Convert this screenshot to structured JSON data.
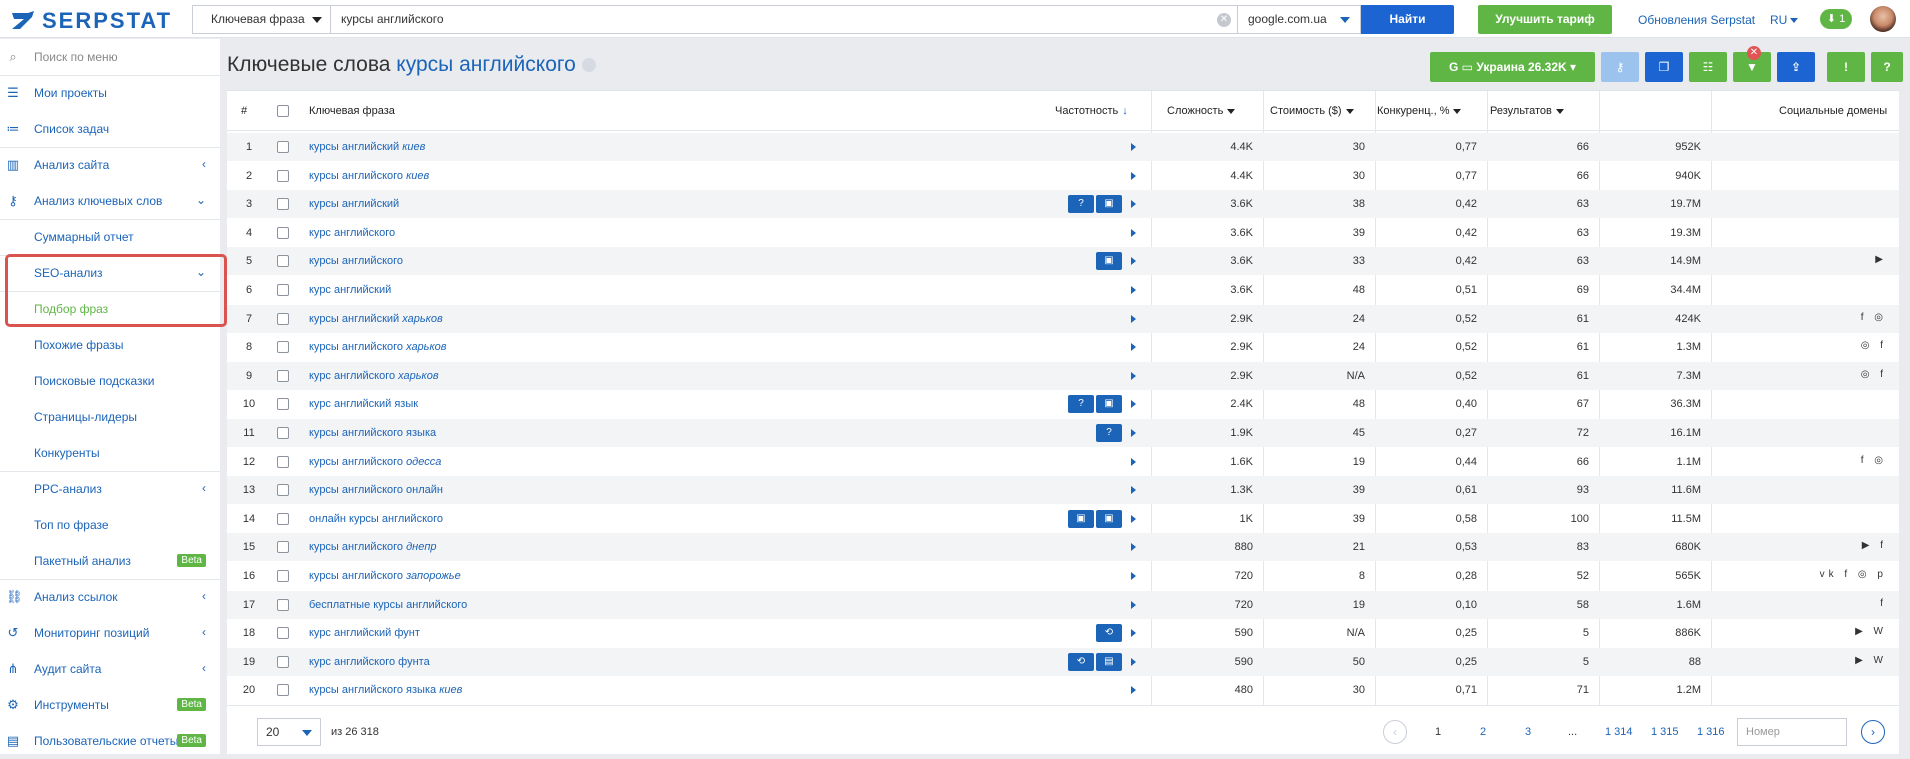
{
  "top": {
    "logo": "SERPSTAT",
    "search_type": "Ключевая фраза",
    "query": "курсы английского",
    "database": "google.com.ua",
    "find_button": "Найти",
    "upgrade_button": "Улучшить тариф",
    "updates_link": "Обновления Serpstat",
    "lang": "RU",
    "downloads_count": "1"
  },
  "sidebar": {
    "menu_search": "Поиск по меню",
    "projects": "Мои проекты",
    "tasks": "Список задач",
    "site_analysis": "Анализ сайта",
    "kw_analysis": "Анализ ключевых слов",
    "summary": "Суммарный отчет",
    "seo": "SEO-анализ",
    "phrase_select": "Подбор фраз",
    "similar": "Похожие фразы",
    "suggestions": "Поисковые подсказки",
    "leaders": "Страницы-лидеры",
    "competitors": "Конкуренты",
    "ppc": "PPC-анализ",
    "top_phrase": "Топ по фразе",
    "batch": "Пакетный анализ",
    "links": "Анализ ссылок",
    "monitoring": "Мониторинг позиций",
    "audit": "Аудит сайта",
    "tools": "Инструменты",
    "custom_reports": "Пользовательские отчеты",
    "beta": "Beta"
  },
  "page": {
    "title_prefix": "Ключевые слова",
    "title_keyword": "курсы английского",
    "region_button": "Украина 26.32K"
  },
  "table": {
    "headers": {
      "num": "#",
      "phrase": "Ключевая фраза",
      "freq": "Частотность",
      "difficulty": "Сложность",
      "cost": "Стоимость ($)",
      "competition": "Конкуренц., %",
      "results": "Результатов",
      "social": "Социальные домены"
    },
    "rows": [
      {
        "n": "1",
        "kw": "курсы английский ",
        "it": "киев",
        "f": "4.4K",
        "d": "30",
        "c": "0,77",
        "k": "66",
        "r": "952K",
        "s": "",
        "b": []
      },
      {
        "n": "2",
        "kw": "курсы английского ",
        "it": "киев",
        "f": "4.4K",
        "d": "30",
        "c": "0,77",
        "k": "66",
        "r": "940K",
        "s": "",
        "b": []
      },
      {
        "n": "3",
        "kw": "курсы английский",
        "it": "",
        "f": "3.6K",
        "d": "38",
        "c": "0,42",
        "k": "63",
        "r": "19.7M",
        "s": "",
        "b": [
          "?",
          "▣"
        ]
      },
      {
        "n": "4",
        "kw": "курс английского",
        "it": "",
        "f": "3.6K",
        "d": "39",
        "c": "0,42",
        "k": "63",
        "r": "19.3M",
        "s": "",
        "b": []
      },
      {
        "n": "5",
        "kw": "курсы английского",
        "it": "",
        "f": "3.6K",
        "d": "33",
        "c": "0,42",
        "k": "63",
        "r": "14.9M",
        "s": "▶",
        "b": [
          "▣"
        ]
      },
      {
        "n": "6",
        "kw": "курс английский",
        "it": "",
        "f": "3.6K",
        "d": "48",
        "c": "0,51",
        "k": "69",
        "r": "34.4M",
        "s": "",
        "b": []
      },
      {
        "n": "7",
        "kw": "курсы английский ",
        "it": "харьков",
        "f": "2.9K",
        "d": "24",
        "c": "0,52",
        "k": "61",
        "r": "424K",
        "s": "f ◎",
        "b": []
      },
      {
        "n": "8",
        "kw": "курсы английского ",
        "it": "харьков",
        "f": "2.9K",
        "d": "24",
        "c": "0,52",
        "k": "61",
        "r": "1.3M",
        "s": "◎ f",
        "b": []
      },
      {
        "n": "9",
        "kw": "курс английского ",
        "it": "харьков",
        "f": "2.9K",
        "d": "N/A",
        "c": "0,52",
        "k": "61",
        "r": "7.3M",
        "s": "◎ f",
        "b": []
      },
      {
        "n": "10",
        "kw": "курс английский язык",
        "it": "",
        "f": "2.4K",
        "d": "48",
        "c": "0,40",
        "k": "67",
        "r": "36.3M",
        "s": "",
        "b": [
          "?",
          "▣"
        ]
      },
      {
        "n": "11",
        "kw": "курсы английского языка",
        "it": "",
        "f": "1.9K",
        "d": "45",
        "c": "0,27",
        "k": "72",
        "r": "16.1M",
        "s": "",
        "b": [
          "?"
        ]
      },
      {
        "n": "12",
        "kw": "курсы английского ",
        "it": "одесса",
        "f": "1.6K",
        "d": "19",
        "c": "0,44",
        "k": "66",
        "r": "1.1M",
        "s": "f ◎",
        "b": []
      },
      {
        "n": "13",
        "kw": "курсы английского онлайн",
        "it": "",
        "f": "1.3K",
        "d": "39",
        "c": "0,61",
        "k": "93",
        "r": "11.6M",
        "s": "",
        "b": []
      },
      {
        "n": "14",
        "kw": "онлайн курсы английского",
        "it": "",
        "f": "1K",
        "d": "39",
        "c": "0,58",
        "k": "100",
        "r": "11.5M",
        "s": "",
        "b": [
          "▣",
          "▣"
        ]
      },
      {
        "n": "15",
        "kw": "курсы английского ",
        "it": "днепр",
        "f": "880",
        "d": "21",
        "c": "0,53",
        "k": "83",
        "r": "680K",
        "s": "▶ f",
        "b": []
      },
      {
        "n": "16",
        "kw": "курсы английского ",
        "it": "запорожье",
        "f": "720",
        "d": "8",
        "c": "0,28",
        "k": "52",
        "r": "565K",
        "s": "vk f ◎ p",
        "b": []
      },
      {
        "n": "17",
        "kw": "бесплатные курсы английского",
        "it": "",
        "f": "720",
        "d": "19",
        "c": "0,10",
        "k": "58",
        "r": "1.6M",
        "s": "f",
        "b": []
      },
      {
        "n": "18",
        "kw": "курс английский фунт",
        "it": "",
        "f": "590",
        "d": "N/A",
        "c": "0,25",
        "k": "5",
        "r": "886K",
        "s": "▶ W",
        "b": [
          "⟲"
        ]
      },
      {
        "n": "19",
        "kw": "курс английского фунта",
        "it": "",
        "f": "590",
        "d": "50",
        "c": "0,25",
        "k": "5",
        "r": "88",
        "s": "▶ W",
        "b": [
          "⟲",
          "▤"
        ]
      },
      {
        "n": "20",
        "kw": "курсы английского языка ",
        "it": "киев",
        "f": "480",
        "d": "30",
        "c": "0,71",
        "k": "71",
        "r": "1.2M",
        "s": "",
        "b": []
      }
    ]
  },
  "footer": {
    "per_page": "20",
    "of_total": "из 26 318",
    "pages": [
      "1",
      "2",
      "3",
      "...",
      "1 314",
      "1 315",
      "1 316"
    ],
    "page_input_placeholder": "Номер"
  }
}
